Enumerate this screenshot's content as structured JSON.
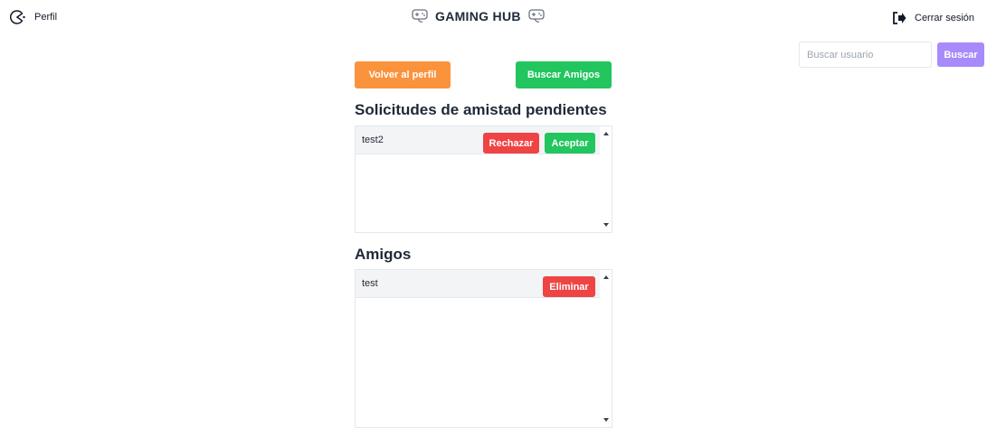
{
  "nav": {
    "profile_label": "Perfil",
    "profile_icon": "pacman-ghost-icon",
    "brand_title": "GAMING HUB",
    "brand_icon": "gamepad-icon",
    "logout_label": "Cerrar sesión",
    "logout_icon": "sign-out-icon"
  },
  "search": {
    "placeholder": "Buscar usuario",
    "value": "",
    "button_label": "Buscar"
  },
  "actions": {
    "back_label": "Volver al perfil",
    "find_friends_label": "Buscar Amigos"
  },
  "requests": {
    "heading": "Solicitudes de amistad pendientes",
    "items": [
      {
        "name": "test2",
        "reject_label": "Rechazar",
        "accept_label": "Aceptar"
      }
    ]
  },
  "friends": {
    "heading": "Amigos",
    "items": [
      {
        "name": "test",
        "delete_label": "Eliminar"
      }
    ]
  },
  "colors": {
    "orange": "#fb923c",
    "green": "#22c55e",
    "red": "#ef4444",
    "purple": "#a78bfa"
  }
}
